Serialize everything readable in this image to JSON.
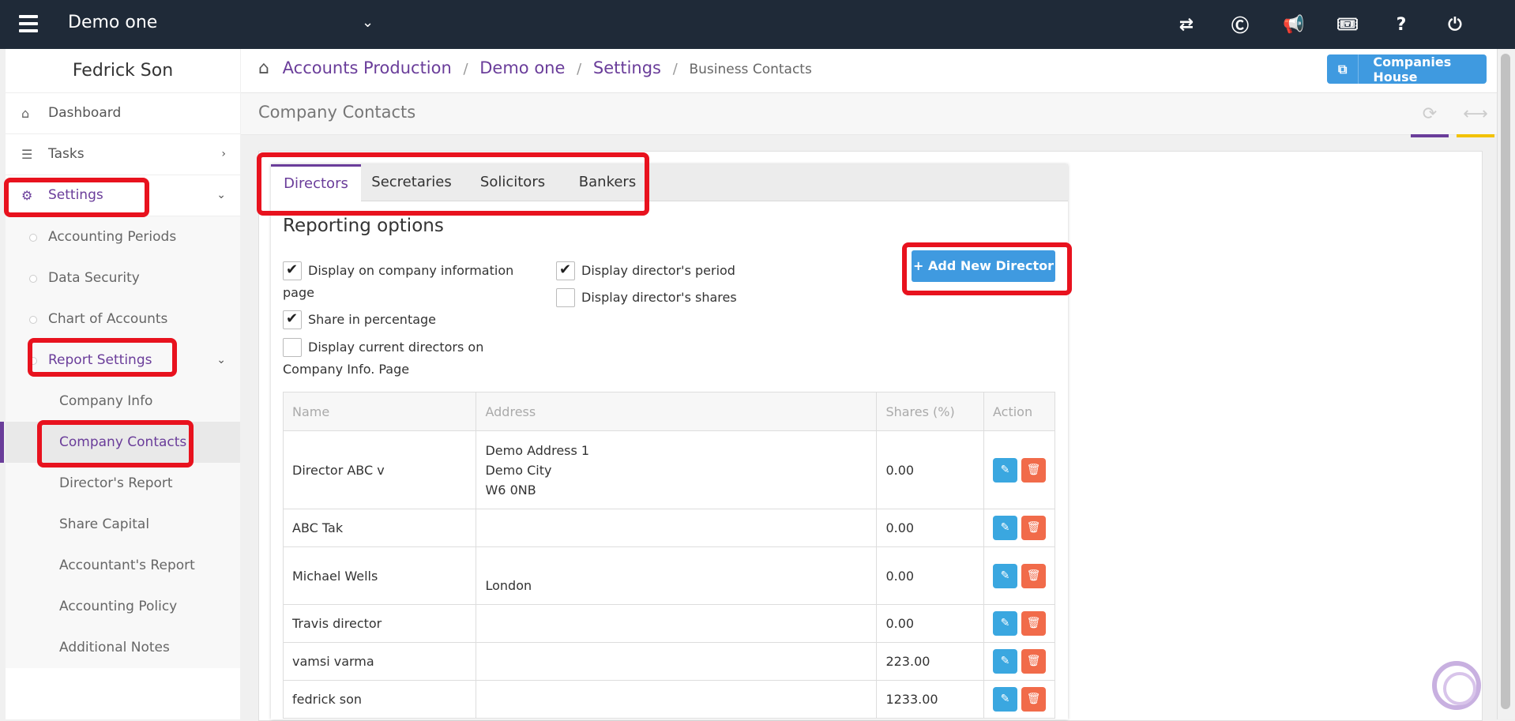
{
  "topbar": {
    "company": "Demo one",
    "icons": [
      "transfer-icon",
      "copyright-icon",
      "megaphone-icon",
      "ticket-icon",
      "help-icon",
      "power-icon"
    ],
    "icon_glyphs": [
      "⇄",
      "Ⓒ",
      "📢",
      "🎟",
      "?",
      "⏻"
    ]
  },
  "sidebar": {
    "user": "Fedrick Son",
    "items": [
      {
        "label": "Dashboard",
        "icon": "⌂"
      },
      {
        "label": "Tasks",
        "icon": "☰",
        "chev": "›"
      },
      {
        "label": "Settings",
        "icon": "⚙",
        "chev": "⌄"
      }
    ],
    "settings_sub": [
      {
        "label": "Accounting Periods"
      },
      {
        "label": "Data Security"
      },
      {
        "label": "Chart of Accounts"
      },
      {
        "label": "Report Settings",
        "chev": "⌄"
      }
    ],
    "report_sub": [
      {
        "label": "Company Info"
      },
      {
        "label": "Company Contacts"
      },
      {
        "label": "Director's Report"
      },
      {
        "label": "Share Capital"
      },
      {
        "label": "Accountant's Report"
      },
      {
        "label": "Accounting Policy"
      },
      {
        "label": "Additional Notes"
      }
    ]
  },
  "breadcrumb": {
    "items": [
      "Accounts Production",
      "Demo one",
      "Settings"
    ],
    "sep": "/",
    "current": "Business Contacts",
    "home_icon": "⌂"
  },
  "companies_house_button": {
    "label": "Companies House",
    "icon": "⧉"
  },
  "page": {
    "title": "Company Contacts",
    "refresh_icon": "⟳",
    "expand_icon": "⟷"
  },
  "tabs": [
    "Directors",
    "Secretaries",
    "Solicitors",
    "Bankers"
  ],
  "reporting": {
    "title": "Reporting options",
    "options": [
      {
        "label": "Display on company information page",
        "checked": true
      },
      {
        "label": "Share in percentage",
        "checked": true
      },
      {
        "label": "Display current directors on Company Info. Page",
        "checked": false
      },
      {
        "label": "Display director's period",
        "checked": true
      },
      {
        "label": "Display director's shares",
        "checked": false
      }
    ]
  },
  "add_button": {
    "label": "Add New Director",
    "icon": "+"
  },
  "table": {
    "headers": [
      "Name",
      "Address",
      "Shares (%)",
      "Action"
    ],
    "rows": [
      {
        "name": "Director ABC v",
        "address": [
          "Demo Address 1",
          "Demo City",
          "W6 0NB"
        ],
        "shares": "0.00"
      },
      {
        "name": "ABC Tak",
        "address": [],
        "shares": "0.00"
      },
      {
        "name": "Michael Wells",
        "address": [
          "London"
        ],
        "shares": "0.00"
      },
      {
        "name": "Travis director",
        "address": [],
        "shares": "0.00"
      },
      {
        "name": "vamsi varma",
        "address": [],
        "shares": "223.00"
      },
      {
        "name": "fedrick son",
        "address": [],
        "shares": "1233.00"
      }
    ],
    "edit_icon": "✎",
    "delete_icon": "🗑"
  },
  "colors": {
    "accent": "#6a3d9a",
    "primary_button": "#3f9ae0",
    "topbar": "#1f2a38",
    "edit": "#3aa7e0",
    "delete": "#f16b4a",
    "highlight": "#e8121e"
  }
}
